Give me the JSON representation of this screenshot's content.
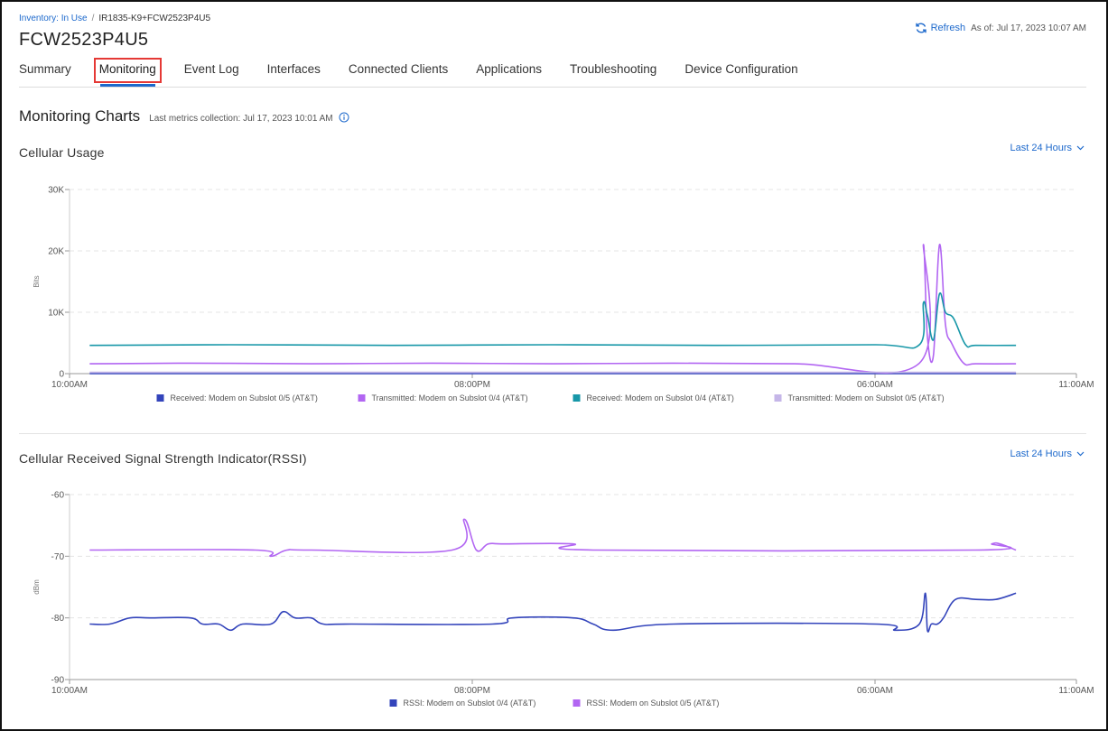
{
  "breadcrumb": {
    "link": "Inventory: In Use",
    "separator": "/",
    "current": "IR1835-K9+FCW2523P4U5"
  },
  "device_title": "FCW2523P4U5",
  "refresh": {
    "label": "Refresh",
    "as_of": "As of: Jul 17, 2023 10:07 AM"
  },
  "tabs": [
    {
      "label": "Summary"
    },
    {
      "label": "Monitoring",
      "active": true
    },
    {
      "label": "Event Log"
    },
    {
      "label": "Interfaces"
    },
    {
      "label": "Connected Clients"
    },
    {
      "label": "Applications"
    },
    {
      "label": "Troubleshooting"
    },
    {
      "label": "Device Configuration"
    }
  ],
  "monitoring": {
    "title": "Monitoring Charts",
    "last_collection": "Last metrics collection: Jul 17, 2023 10:01 AM"
  },
  "colors": {
    "accent": "#1d69cc",
    "highlight": "#e53935"
  },
  "chart_data": [
    {
      "type": "line",
      "title": "Cellular Usage",
      "range_label": "Last 24 Hours",
      "ylabel": "Bits",
      "ylim": [
        0,
        30000
      ],
      "y_ticks": [
        0,
        10000,
        20000,
        30000
      ],
      "y_tick_labels": [
        "0",
        "10K",
        "20K",
        "30K"
      ],
      "x_ticks": [
        "10:00AM",
        "08:00PM",
        "06:00AM",
        "11:00AM"
      ],
      "x_tick_hours": [
        0,
        10,
        20,
        25
      ],
      "grid": true,
      "legend_position": "bottom",
      "series": [
        {
          "name": "Received: Modem on Subslot 0/5 (AT&T)",
          "color": "#3344bb",
          "x": [
            0.5,
            23.5
          ],
          "y": [
            0,
            0
          ]
        },
        {
          "name": "Transmitted: Modem on Subslot 0/4 (AT&T)",
          "color": "#b266f2",
          "x": [
            0.5,
            3,
            6,
            9,
            12,
            15,
            18,
            21.1,
            21.2,
            21.3,
            21.45,
            21.6,
            21.75,
            21.9,
            22.2,
            22.5,
            23.5
          ],
          "y": [
            1600,
            1700,
            1600,
            1700,
            1600,
            1700,
            1600,
            1700,
            21000,
            6000,
            3000,
            21000,
            8000,
            5000,
            1700,
            1600,
            1600
          ]
        },
        {
          "name": "Received: Modem on Subslot 0/4 (AT&T)",
          "color": "#1797a8",
          "x": [
            0.5,
            4,
            8,
            12,
            16,
            20,
            21.1,
            21.2,
            21.3,
            21.45,
            21.6,
            21.75,
            21.95,
            22.25,
            22.5,
            23.5
          ],
          "y": [
            4600,
            4700,
            4600,
            4700,
            4600,
            4700,
            4700,
            11500,
            9500,
            5500,
            13000,
            10000,
            9000,
            4700,
            4600,
            4600
          ]
        },
        {
          "name": "Transmitted: Modem on Subslot 0/5 (AT&T)",
          "color": "#c5b6e8",
          "x": [
            0.5,
            23.5
          ],
          "y": [
            200,
            200
          ]
        }
      ]
    },
    {
      "type": "line",
      "title": "Cellular Received Signal Strength Indicator(RSSI)",
      "range_label": "Last 24 Hours",
      "ylabel": "dBm",
      "ylim": [
        -90,
        -60
      ],
      "y_ticks": [
        -90,
        -80,
        -70,
        -60
      ],
      "y_tick_labels": [
        "-90",
        "-80",
        "-70",
        "-60"
      ],
      "x_ticks": [
        "10:00AM",
        "08:00PM",
        "06:00AM",
        "11:00AM"
      ],
      "x_tick_hours": [
        0,
        10,
        20,
        25
      ],
      "grid": true,
      "legend_position": "bottom",
      "series": [
        {
          "name": "RSSI: Modem on Subslot 0/4 (AT&T)",
          "color": "#3344bb",
          "x": [
            0.5,
            1,
            1.5,
            2,
            3,
            3.3,
            3.7,
            4,
            4.3,
            5,
            5.3,
            5.6,
            6,
            6.3,
            7,
            10.5,
            11,
            12.5,
            13,
            13.5,
            15,
            20,
            20.5,
            21.1,
            21.25,
            21.3,
            21.4,
            21.55,
            21.7,
            22,
            22.5,
            23,
            23.5
          ],
          "y": [
            -81,
            -81,
            -80,
            -80,
            -80,
            -81,
            -81,
            -82,
            -81,
            -81,
            -79,
            -80,
            -80,
            -81,
            -81,
            -81,
            -80,
            -80,
            -81,
            -82,
            -81,
            -81,
            -82,
            -81,
            -76,
            -82,
            -81,
            -81,
            -80,
            -77,
            -77,
            -77,
            -76
          ]
        },
        {
          "name": "RSSI: Modem on Subslot 0/5 (AT&T)",
          "color": "#b266f2",
          "x": [
            0.5,
            4.6,
            5,
            5.4,
            6,
            9.5,
            9.8,
            10.1,
            10.4,
            10.8,
            12.5,
            13,
            22.5,
            22.9,
            23.1,
            23.5
          ],
          "y": [
            -69,
            -69,
            -70,
            -69,
            -69,
            -69,
            -64,
            -69,
            -68,
            -68,
            -68,
            -69,
            -69,
            -68,
            -68,
            -69
          ]
        }
      ]
    }
  ]
}
